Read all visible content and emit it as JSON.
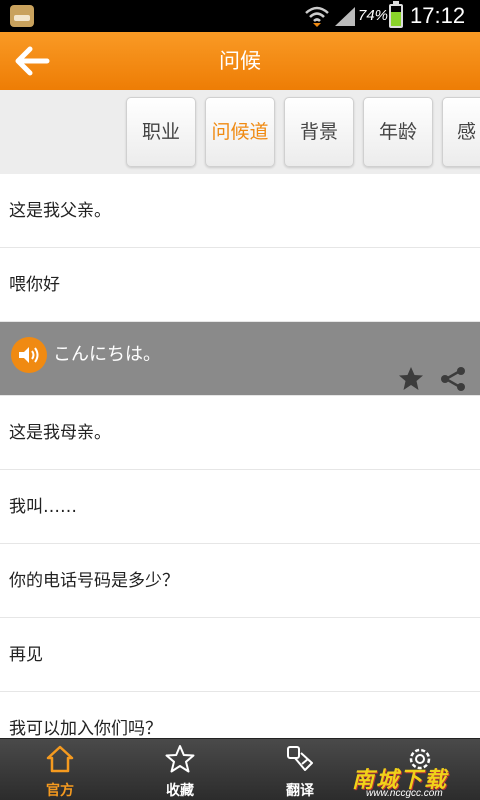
{
  "status_bar": {
    "battery_percent": "74%",
    "time": "17:12"
  },
  "app_bar": {
    "title": "问候"
  },
  "tabs": [
    {
      "label": "职业",
      "active": false
    },
    {
      "label": "问候道",
      "active": true
    },
    {
      "label": "背景",
      "active": false
    },
    {
      "label": "年龄",
      "active": false
    },
    {
      "label": "感",
      "active": false
    }
  ],
  "phrases": [
    {
      "text": "这是我父亲。"
    },
    {
      "text": "喂你好"
    },
    {
      "expanded": true,
      "translation": "こんにちは。"
    },
    {
      "text": "这是我母亲。"
    },
    {
      "text": "我叫……"
    },
    {
      "text": "你的电话号码是多少？"
    },
    {
      "text": "再见"
    },
    {
      "text": "我可以加入你们吗？"
    }
  ],
  "bottom_nav": [
    {
      "label": "官方",
      "icon": "home-icon",
      "active": true
    },
    {
      "label": "收藏",
      "icon": "star-icon",
      "active": false
    },
    {
      "label": "翻译",
      "icon": "translate-icon",
      "active": false
    },
    {
      "label": "",
      "icon": "gear-icon",
      "active": false
    }
  ],
  "watermark": {
    "main": "南城下载",
    "sub": "www.nccgcc.com"
  },
  "colors": {
    "accent": "#f08a12",
    "app_bar": "#f5901a",
    "expanded_row": "#8a8a8a",
    "nav_bg": "#333333"
  }
}
